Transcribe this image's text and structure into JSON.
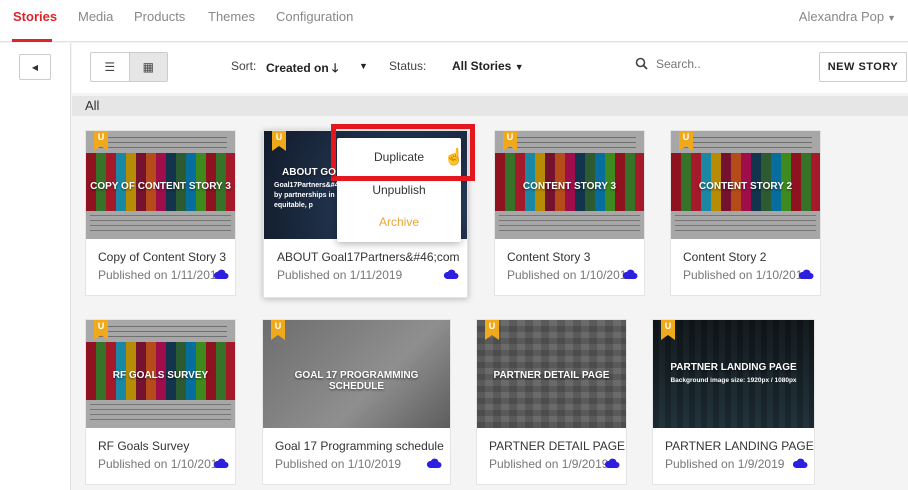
{
  "nav": {
    "items": [
      "Stories",
      "Media",
      "Products",
      "Themes",
      "Configuration"
    ],
    "user": "Alexandra Pop"
  },
  "toolbar": {
    "sort_label": "Sort:",
    "sort_value": "Created on",
    "status_label": "Status:",
    "status_value": "All Stories",
    "search_placeholder": "Search..",
    "new_story": "NEW STORY"
  },
  "section": {
    "title": "All"
  },
  "stories": [
    {
      "badge": "U",
      "thumb_title": "COPY OF CONTENT STORY 3",
      "thumb_sub": "",
      "name": "Copy of Content Story 3",
      "date": "Published on 1/11/2019"
    },
    {
      "badge": "U",
      "thumb_title": "ABOUT GO",
      "thumb_sub": "Goal17Partners&#46;co by partnerships in equitable, p",
      "name": "ABOUT Goal17Partners&#46;com",
      "date": "Published on 1/11/2019"
    },
    {
      "badge": "U",
      "thumb_title": "CONTENT STORY 3",
      "thumb_sub": "",
      "name": "Content Story 3",
      "date": "Published on 1/10/2019"
    },
    {
      "badge": "U",
      "thumb_title": "CONTENT STORY 2",
      "thumb_sub": "",
      "name": "Content Story 2",
      "date": "Published on 1/10/2019"
    },
    {
      "badge": "U",
      "thumb_title": "RF GOALS SURVEY",
      "thumb_sub": "",
      "name": "RF Goals Survey",
      "date": "Published on 1/10/2019"
    },
    {
      "badge": "U",
      "thumb_title": "GOAL 17 PROGRAMMING SCHEDULE",
      "thumb_sub": "",
      "name": "Goal 17 Programming schedule",
      "date": "Published on 1/10/2019"
    },
    {
      "badge": "U",
      "thumb_title": "PARTNER DETAIL PAGE",
      "thumb_sub": "",
      "name": "PARTNER DETAIL PAGE",
      "date": "Published on 1/9/2019"
    },
    {
      "badge": "U",
      "thumb_title": "PARTNER LANDING PAGE",
      "thumb_sub": "Background image size: 1920px / 1080px",
      "name": "PARTNER LANDING PAGE",
      "date": "Published on 1/9/2019"
    }
  ],
  "context_menu": {
    "items": [
      "Duplicate",
      "Unpublish",
      "Archive"
    ]
  },
  "colors": {
    "accent": "#d9262c",
    "badge": "#f0a91a",
    "archive": "#e8a53a",
    "cloud": "#2d1fe0",
    "highlight": "#e4161e"
  }
}
